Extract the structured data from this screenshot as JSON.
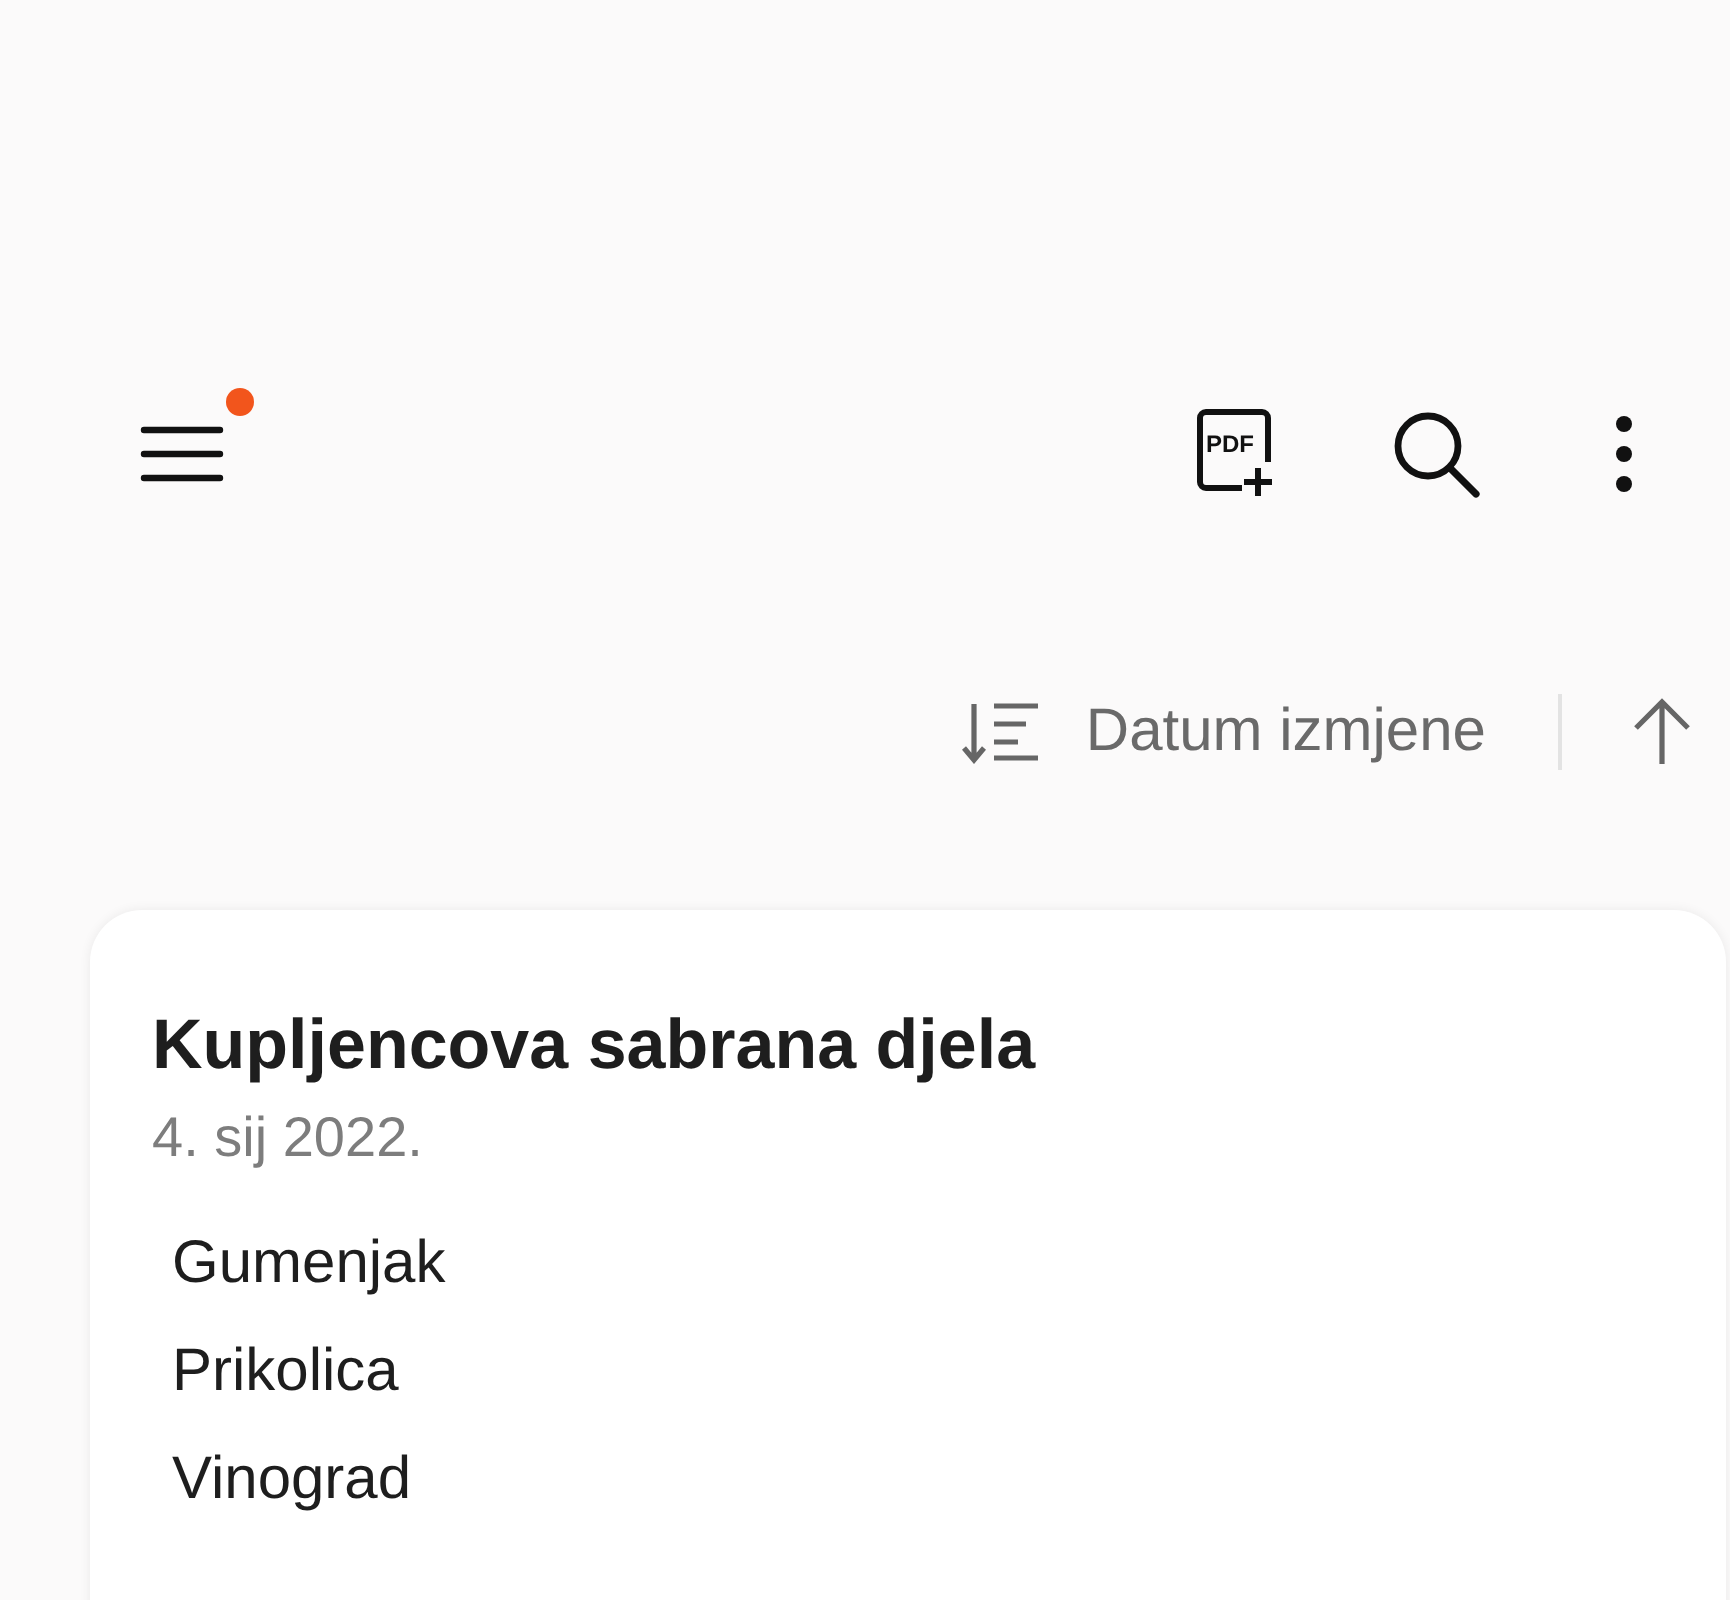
{
  "toolbar": {
    "menu_badge": true,
    "pdf_icon_text": "PDF"
  },
  "sort": {
    "label": "Datum izmjene"
  },
  "note": {
    "title": "Kupljencova sabrana djela",
    "date": "4. sij 2022.",
    "lines": [
      "Gumenjak",
      "Prikolica",
      "Vinograd"
    ]
  }
}
